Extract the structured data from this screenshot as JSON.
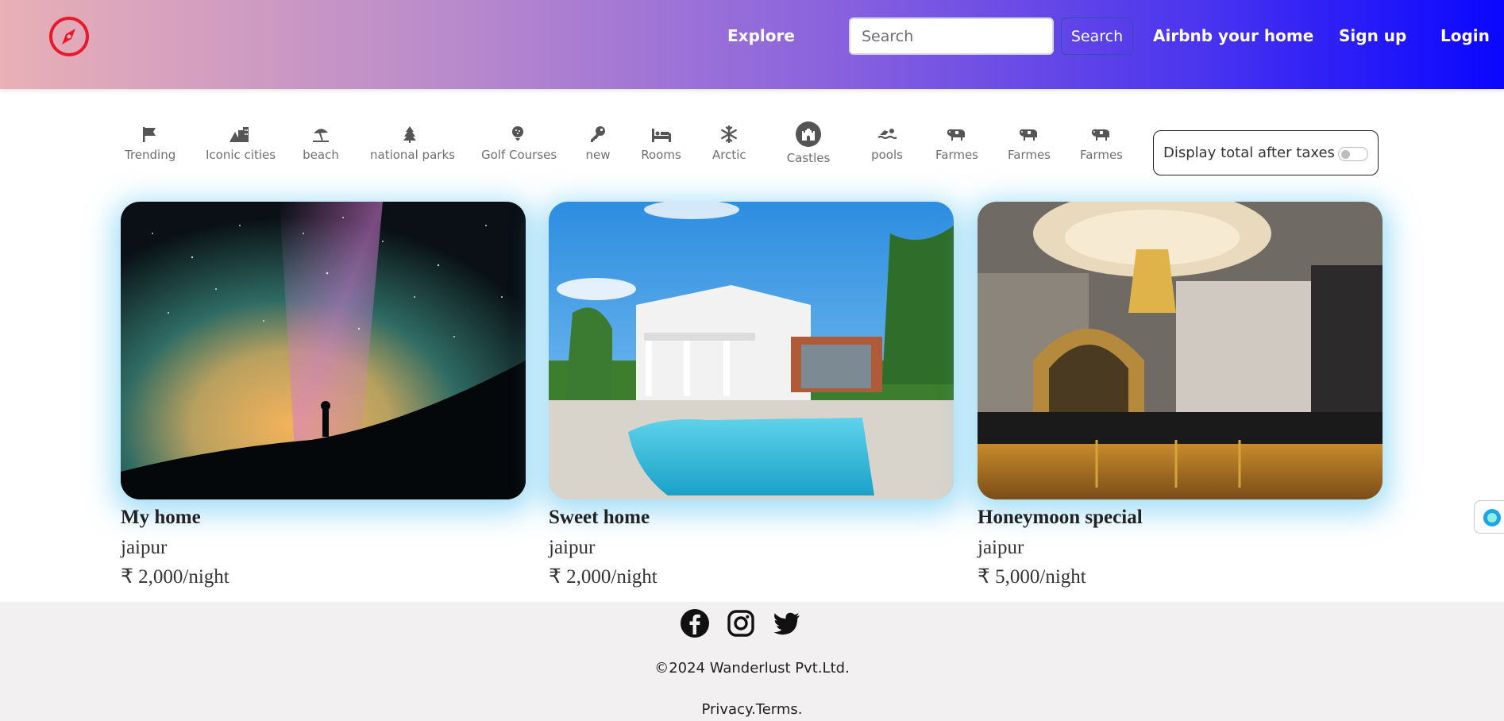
{
  "brand": {
    "logo_icon": "compass-icon",
    "color": "#e8192c"
  },
  "nav": {
    "explore": "Explore",
    "search_placeholder": "Search",
    "search_button": "Search",
    "host": "Airbnb your home",
    "signup": "Sign up",
    "login": "Login"
  },
  "filters": [
    {
      "label": "Trending",
      "icon": "flag-icon"
    },
    {
      "label": "Iconic cities",
      "icon": "city-icon"
    },
    {
      "label": "beach",
      "icon": "umbrella-beach-icon"
    },
    {
      "label": "national parks",
      "icon": "tree-icon"
    },
    {
      "label": "Golf Courses",
      "icon": "golf-ball-icon"
    },
    {
      "label": "new",
      "icon": "key-icon"
    },
    {
      "label": "Rooms",
      "icon": "bed-icon"
    },
    {
      "label": "Arctic",
      "icon": "snowflake-icon"
    },
    {
      "label": "Castles",
      "icon": "castle-icon"
    },
    {
      "label": "pools",
      "icon": "swimmer-icon"
    },
    {
      "label": "Farmes",
      "icon": "cow-icon"
    },
    {
      "label": "Farmes",
      "icon": "cow-icon"
    },
    {
      "label": "Farmes",
      "icon": "cow-icon"
    }
  ],
  "tax_toggle": {
    "label": "Display total after taxes",
    "enabled": false
  },
  "listings": [
    {
      "title": "My home",
      "location": "jaipur",
      "price": "₹ 2,000/night"
    },
    {
      "title": "Sweet home",
      "location": "jaipur",
      "price": "₹ 2,000/night"
    },
    {
      "title": "Honeymoon special",
      "location": "jaipur",
      "price": "₹ 5,000/night"
    }
  ],
  "footer": {
    "social_icons": [
      "facebook-icon",
      "instagram-icon",
      "twitter-icon"
    ],
    "copyright": "©2024 Wanderlust Pvt.Ltd.",
    "privacy": "Privacy.",
    "terms": "Terms."
  },
  "colors": {
    "card_glow": "#5cc4f0",
    "footer_bg": "#f2f0f0"
  }
}
